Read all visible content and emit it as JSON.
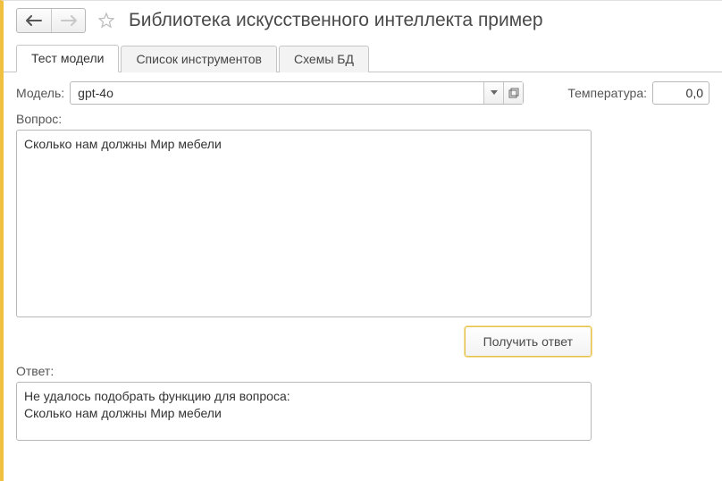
{
  "title": "Библиотека искусственного интеллекта пример",
  "tabs": [
    {
      "label": "Тест модели",
      "active": true
    },
    {
      "label": "Список инструментов",
      "active": false
    },
    {
      "label": "Схемы БД",
      "active": false
    }
  ],
  "model": {
    "label": "Модель",
    "value": "gpt-4o"
  },
  "temperature": {
    "label": "Температура",
    "value": "0,0"
  },
  "question": {
    "label": "Вопрос",
    "text": "Сколько нам должны Мир мебели"
  },
  "action": {
    "get_answer": "Получить ответ"
  },
  "answer": {
    "label": "Ответ",
    "text": "Не удалось подобрать функцию для вопроса:\nСколько нам должны Мир мебели"
  }
}
